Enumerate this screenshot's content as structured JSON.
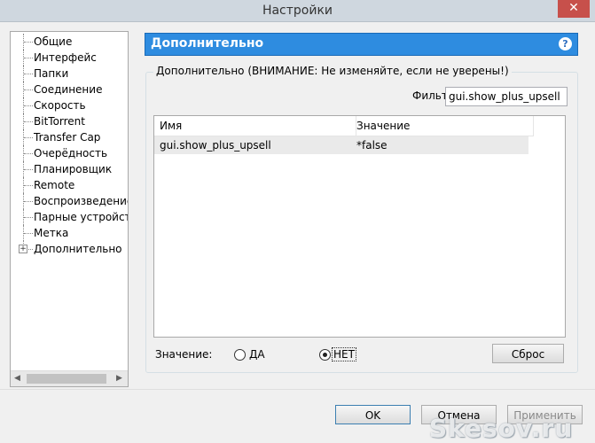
{
  "window": {
    "title": "Настройки",
    "close_symbol": "✕"
  },
  "sidebar": {
    "items": [
      {
        "label": "Общие"
      },
      {
        "label": "Интерфейс"
      },
      {
        "label": "Папки"
      },
      {
        "label": "Соединение"
      },
      {
        "label": "Скорость"
      },
      {
        "label": "BitTorrent"
      },
      {
        "label": "Transfer Cap"
      },
      {
        "label": "Очерёдность"
      },
      {
        "label": "Планировщик"
      },
      {
        "label": "Remote"
      },
      {
        "label": "Воспроизведение"
      },
      {
        "label": "Парные устройства"
      },
      {
        "label": "Метка"
      },
      {
        "label": "Дополнительно"
      }
    ],
    "expander_symbol": "+",
    "scroll_left_symbol": "◀",
    "scroll_right_symbol": "▶"
  },
  "header": {
    "title": "Дополнительно",
    "help_symbol": "?"
  },
  "group": {
    "title": "Дополнительно (ВНИМАНИЕ: Не изменяйте, если не уверены!)",
    "filter_label": "Фильт",
    "filter_value": "gui.show_plus_upsell"
  },
  "table": {
    "columns": [
      "Имя",
      "Значение"
    ],
    "rows": [
      {
        "name": "gui.show_plus_upsell",
        "value": "*false"
      }
    ]
  },
  "value_row": {
    "label": "Значение:",
    "yes_label": "ДА",
    "no_label": "НЕТ",
    "selected": "НЕТ",
    "reset_label": "Сброс"
  },
  "footer": {
    "ok_label": "OK",
    "cancel_label": "Отмена",
    "apply_label": "Применить"
  },
  "watermark": "Skesov.ru",
  "colors": {
    "banner": "#2e8ce0",
    "close_button": "#c7504b"
  }
}
